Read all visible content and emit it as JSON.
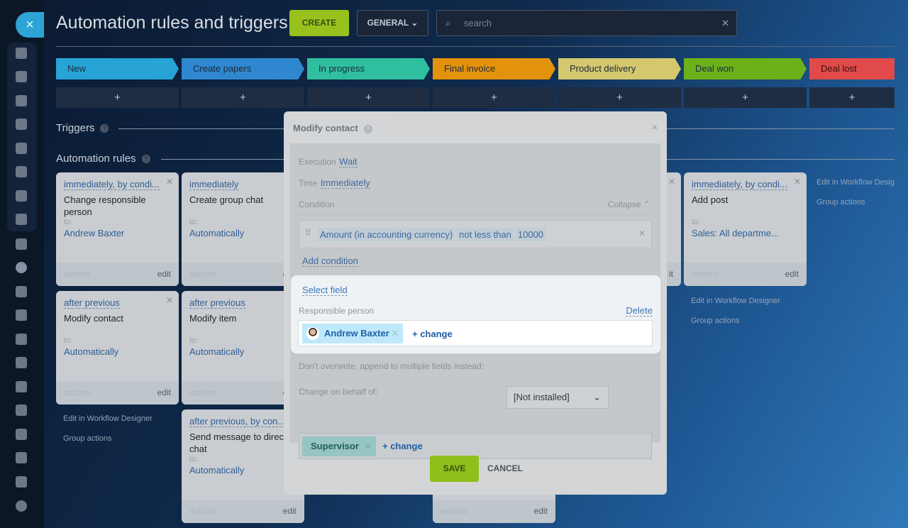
{
  "header": {
    "title": "Automation rules and triggers",
    "create": "CREATE",
    "general": "GENERAL",
    "search_placeholder": "search",
    "close": "×"
  },
  "stages": [
    {
      "label": "New",
      "color": "#27a3d6"
    },
    {
      "label": "Create papers",
      "color": "#2f88cf"
    },
    {
      "label": "In progress",
      "color": "#2fbf9f"
    },
    {
      "label": "Final invoice",
      "color": "#e3920b"
    },
    {
      "label": "Product delivery",
      "color": "#d4c76e"
    },
    {
      "label": "Deal won",
      "color": "#6cb11a"
    },
    {
      "label": "Deal lost",
      "color": "#e04a4a"
    }
  ],
  "plus": "+",
  "sections": {
    "triggers": "Triggers",
    "rules": "Automation rules",
    "help": "?"
  },
  "cards": {
    "c1a": {
      "trigger": "immediately, by condi...",
      "name": "Change responsible person",
      "to": "to:",
      "target": "Andrew Baxter",
      "actions": "actions",
      "edit": "edit"
    },
    "c1b": {
      "trigger": "after previous",
      "name": "Modify contact",
      "to": "to:",
      "target": "Automatically",
      "actions": "actions",
      "edit": "edit"
    },
    "c2a": {
      "trigger": "immediately",
      "name": "Create group chat",
      "to": "to:",
      "target": "Automatically",
      "actions": "actions",
      "edit": "edit"
    },
    "c2b": {
      "trigger": "after previous",
      "name": "Modify item",
      "to": "to:",
      "target": "Automatically",
      "actions": "actions",
      "edit": "edit"
    },
    "c2c": {
      "trigger": "after previous, by con...",
      "name": "Send message to direct chat",
      "to": "to:",
      "target": "Automatically",
      "actions": "actions",
      "edit": "edit"
    },
    "c4": {
      "actions": "actions",
      "edit": "edit"
    },
    "c5": {
      "edit": "it"
    },
    "c6": {
      "trigger": "immediately, by condi...",
      "name": "Add post",
      "to": "to:",
      "target": "Sales: All departme...",
      "actions": "actions",
      "edit": "edit"
    }
  },
  "links": {
    "designer": "Edit in Workflow Designer",
    "designer_cut": "Edit in Workflow Desig",
    "group": "Group actions"
  },
  "modal": {
    "title": "Modify contact",
    "close": "×",
    "execution_label": "Execution",
    "execution_value": "Wait",
    "time_label": "Time",
    "time_value": "Immediately",
    "condition_label": "Condition",
    "collapse": "Collapse",
    "condition": {
      "field": "Amount (in accounting currency)",
      "operator": "not less than",
      "value": "10000"
    },
    "add_condition": "Add condition",
    "select_field": "Select field",
    "field_label": "Responsible person",
    "delete": "Delete",
    "user": "Andrew Baxter",
    "change": "+ change",
    "append_label": "Don't overwrite, append to multiple fields instead:",
    "append_value": "[Not installed]",
    "behalf_label": "Change on behalf of:",
    "behalf_value": "Supervisor",
    "save": "SAVE",
    "cancel": "CANCEL"
  }
}
